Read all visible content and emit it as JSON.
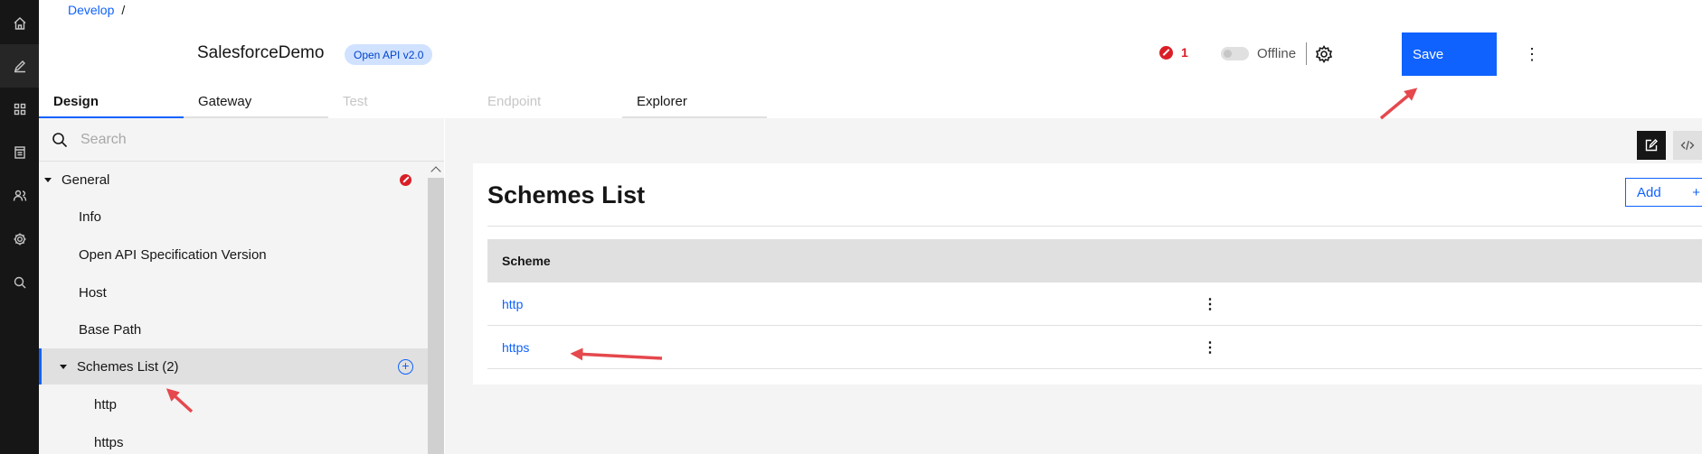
{
  "breadcrumb": {
    "link": "Develop",
    "separator": "/"
  },
  "api": {
    "title": "SalesforceDemo",
    "tag": "Open API v2.0"
  },
  "header": {
    "error_count": "1",
    "toggle_label": "Offline",
    "save_label": "Save",
    "overflow_icon": "⋮"
  },
  "tabs": [
    {
      "label": "Design",
      "state": "active"
    },
    {
      "label": "Gateway",
      "state": "enabled"
    },
    {
      "label": "Test",
      "state": "disabled"
    },
    {
      "label": "Endpoint",
      "state": "disabled"
    },
    {
      "label": "Explorer",
      "state": "enabled"
    }
  ],
  "search": {
    "placeholder": "Search"
  },
  "tree": {
    "general": "General",
    "info": "Info",
    "openapi_version": "Open API Specification Version",
    "host": "Host",
    "base_path": "Base Path",
    "schemes_list": "Schemes List (2)",
    "add_icon": "+",
    "http": "http",
    "https": "https"
  },
  "main": {
    "title": "Schemes List",
    "add_label": "Add",
    "add_icon": "+",
    "column_header": "Scheme",
    "rows": [
      {
        "scheme": "http",
        "menu_icon": "⋮"
      },
      {
        "scheme": "https",
        "menu_icon": "⋮"
      }
    ]
  },
  "colors": {
    "accent": "#0f62fe",
    "rail": "#161616",
    "error": "#da1e28",
    "annotation_arrow": "#e5484d"
  },
  "icons": {
    "rail": [
      "home-icon",
      "edit-icon",
      "apps-grid-icon",
      "catalog-icon",
      "users-icon",
      "settings-icon",
      "search-icon"
    ],
    "view_toggle": [
      "form-edit-icon",
      "code-source-icon"
    ]
  }
}
